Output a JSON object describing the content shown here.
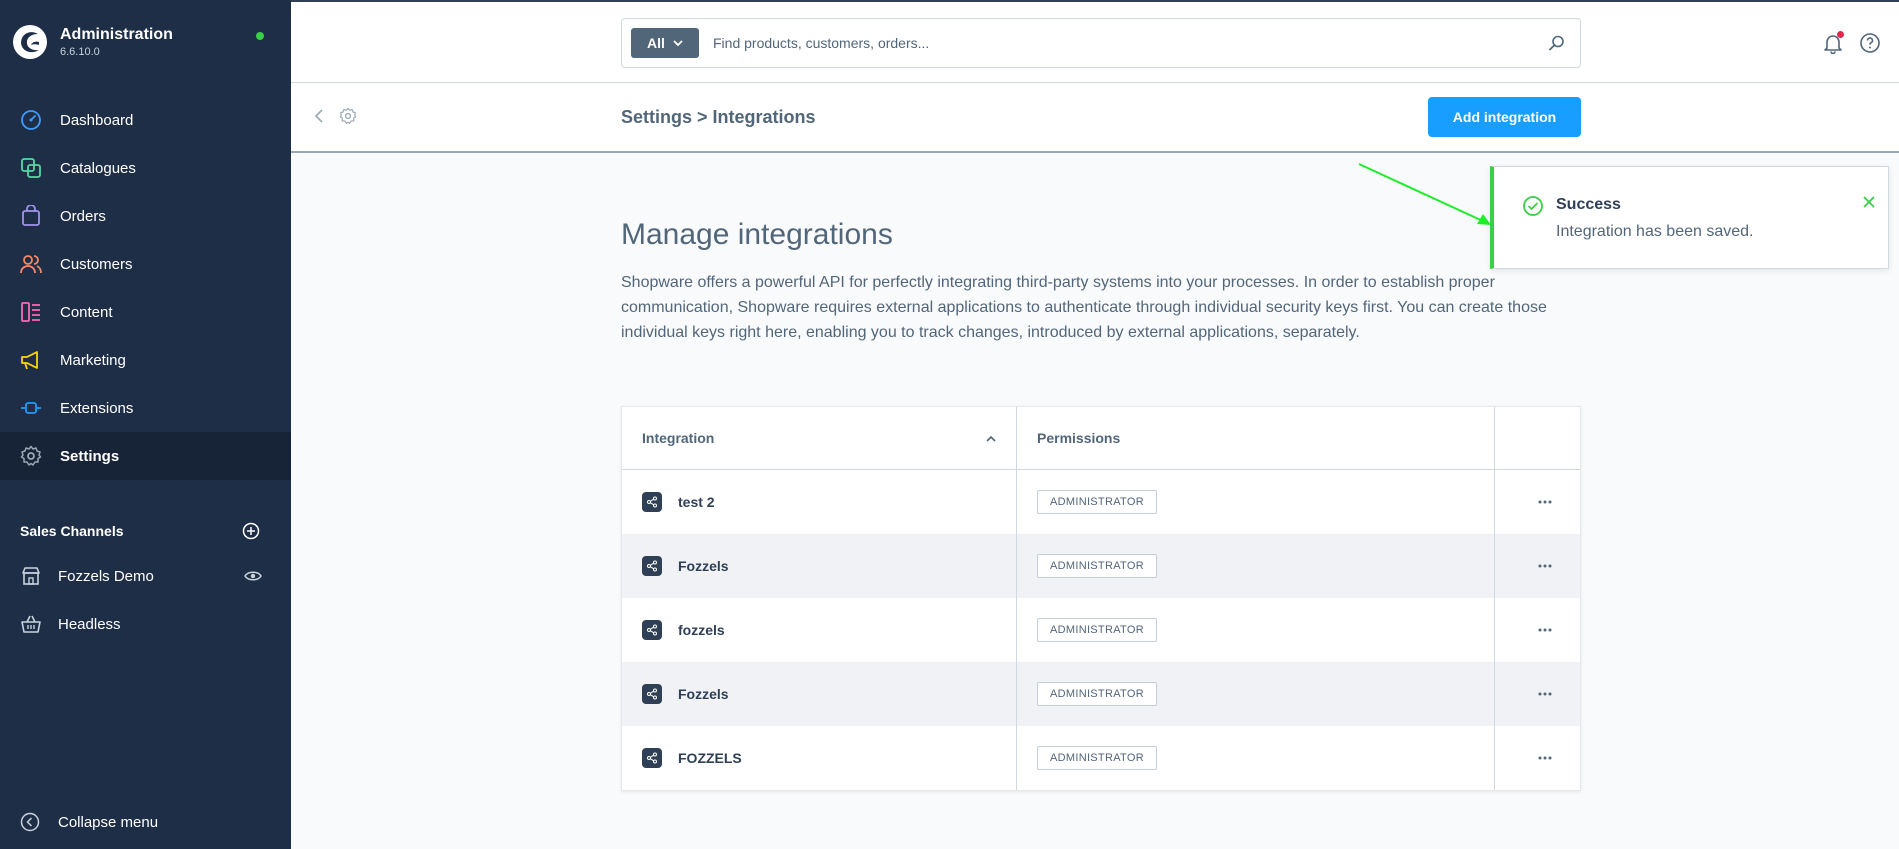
{
  "app": {
    "title": "Administration",
    "version": "6.6.10.0"
  },
  "sidebar": {
    "items": [
      {
        "label": "Dashboard",
        "icon": "dashboard-icon",
        "color": "#3e9bfe"
      },
      {
        "label": "Catalogues",
        "icon": "catalogues-icon",
        "color": "#57d9a3"
      },
      {
        "label": "Orders",
        "icon": "orders-icon",
        "color": "#a092f0"
      },
      {
        "label": "Customers",
        "icon": "customers-icon",
        "color": "#f88962"
      },
      {
        "label": "Content",
        "icon": "content-icon",
        "color": "#ff68b4"
      },
      {
        "label": "Marketing",
        "icon": "marketing-icon",
        "color": "#ffd700"
      },
      {
        "label": "Extensions",
        "icon": "extensions-icon",
        "color": "#189eff"
      },
      {
        "label": "Settings",
        "icon": "settings-icon",
        "color": "#9aa8b5",
        "active": true
      }
    ],
    "sales_channels_title": "Sales Channels",
    "sales_channels": [
      {
        "label": "Fozzels Demo",
        "icon": "storefront-icon"
      },
      {
        "label": "Headless",
        "icon": "basket-icon"
      }
    ],
    "collapse_label": "Collapse menu"
  },
  "search": {
    "type_label": "All",
    "placeholder": "Find products, customers, orders..."
  },
  "header": {
    "breadcrumb": "Settings > Integrations",
    "add_button": "Add integration"
  },
  "main": {
    "title": "Manage integrations",
    "description": "Shopware offers a powerful API for perfectly integrating third-party systems into your processes. In order to establish proper communication, Shopware requires external applications to authenticate through individual security keys first. You can create those individual keys right here, enabling you to track changes, introduced by external applications, separately."
  },
  "table": {
    "columns": [
      "Integration",
      "Permissions"
    ],
    "rows": [
      {
        "name": "test 2",
        "permission": "ADMINISTRATOR"
      },
      {
        "name": "Fozzels",
        "permission": "ADMINISTRATOR"
      },
      {
        "name": "fozzels",
        "permission": "ADMINISTRATOR"
      },
      {
        "name": "Fozzels",
        "permission": "ADMINISTRATOR"
      },
      {
        "name": "FOZZELS",
        "permission": "ADMINISTRATOR"
      }
    ]
  },
  "notification": {
    "title": "Success",
    "message": "Integration has been saved.",
    "color": "#37d046"
  },
  "colors": {
    "sidebar_bg": "#1e2e46",
    "primary": "#189eff",
    "annotation_arrow": "#1aef2a"
  }
}
